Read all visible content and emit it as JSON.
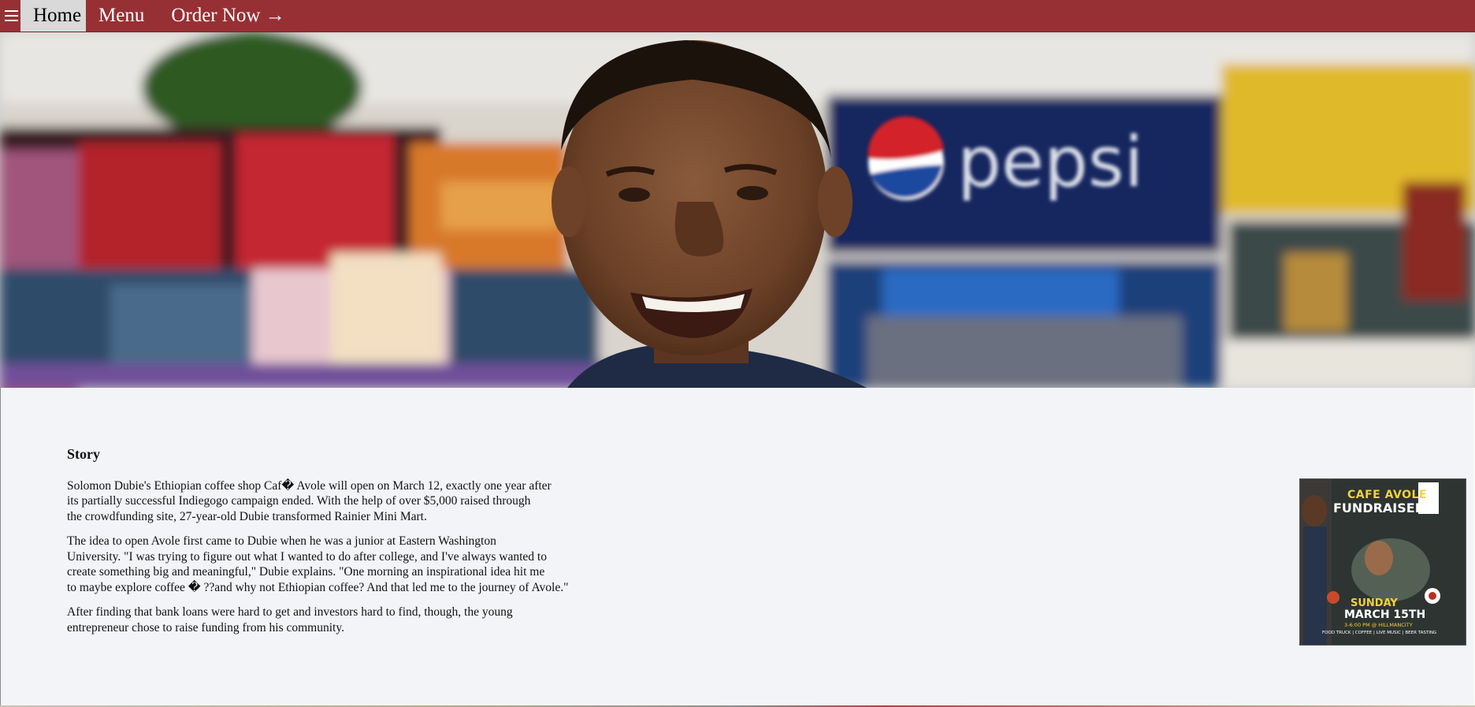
{
  "nav": {
    "menu_icon": "hamburger-menu-icon",
    "items": [
      {
        "label": "Home"
      },
      {
        "label": "Menu"
      },
      {
        "label": "Order Now →"
      }
    ]
  },
  "hero": {
    "logo_text": "pepsi"
  },
  "story": {
    "heading": "Story",
    "paragraphs": [
      "Solomon Dubie's Ethiopian coffee shop Caf� Avole will open on March 12, exactly one year after\nits partially successful Indiegogo campaign ended. With the help of over $5,000 raised through\nthe crowdfunding site, 27-year-old Dubie transformed Rainier Mini Mart.",
      "The idea to open Avole first came to Dubie when he was a junior at Eastern Washington\nUniversity. \"I was trying to figure out what I wanted to do after college, and I've always wanted to\ncreate something big and meaningful,\" Dubie explains. \"One morning an inspirational idea hit me\nto maybe explore coffee � ??and why not Ethiopian coffee? And that led me to the journey of Avole.\"",
      "After finding that bank loans were hard to get and investors hard to find, though, the young\nentrepreneur chose to raise funding from his community."
    ]
  },
  "poster": {
    "line1": "CAFE AVOLE",
    "line2": "FUNDRAISER",
    "line3": "SUNDAY",
    "line4": "MARCH 15TH",
    "line5": "3-6:00 PM @ HILLMANCITY",
    "line6": "FOOD TRUCK | COFFEE | LIVE MUSIC | BEER TASTING"
  },
  "colors": {
    "nav_bg": "#973034",
    "nav_active_bg": "#d9d9d9",
    "content_bg": "#f2f4f7"
  }
}
